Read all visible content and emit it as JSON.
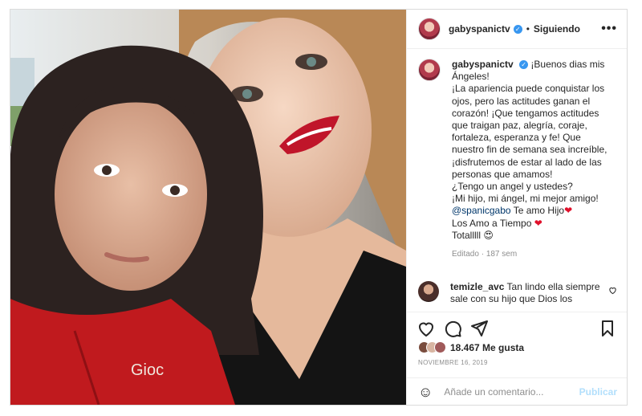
{
  "post": {
    "username": "gabyspanictv",
    "follow_status": "Siguiendo",
    "separator": "•",
    "more_icon": "more-horizontal-icon"
  },
  "caption": {
    "username": "gabyspanictv",
    "lines": [
      "¡Buenos dias mis Ángeles!",
      "¡La apariencia puede conquistar los ojos, pero las actitudes ganan el corazón! ¡Que tengamos actitudes que traigan paz, alegría, coraje, fortaleza, esperanza y fe! Que nuestro fin de semana sea increíble, ¡disfrutemos de estar al lado de las personas que amamos!",
      "¿Tengo un angel y ustedes?",
      "¡Mi hijo, mi ángel, mi mejor amigo!"
    ],
    "mention": "@spanicgabo",
    "mention_rest": " Te amo Hijo",
    "line_love": "Los Amo a Tiempo ",
    "line_total": "Totalllll ",
    "heart": "❤",
    "smile": "😍",
    "edited": "Editado",
    "time_ago": "187 sem"
  },
  "comment": {
    "username": "temizle_avc",
    "text": "Tan lindo ella siempre sale con su hijo que Dios los bendiga a los dos suempre"
  },
  "stats": {
    "likes": "18.467 Me gusta",
    "date": "NOVIEMBRE 16, 2019"
  },
  "composer": {
    "placeholder": "Añade un comentario...",
    "publish_label": "Publicar"
  },
  "photo_label": "Gioc",
  "colors": {
    "verified": "#3897f0",
    "publish": "#b2dffc",
    "mention": "#00376b",
    "heart": "#e0102b"
  }
}
